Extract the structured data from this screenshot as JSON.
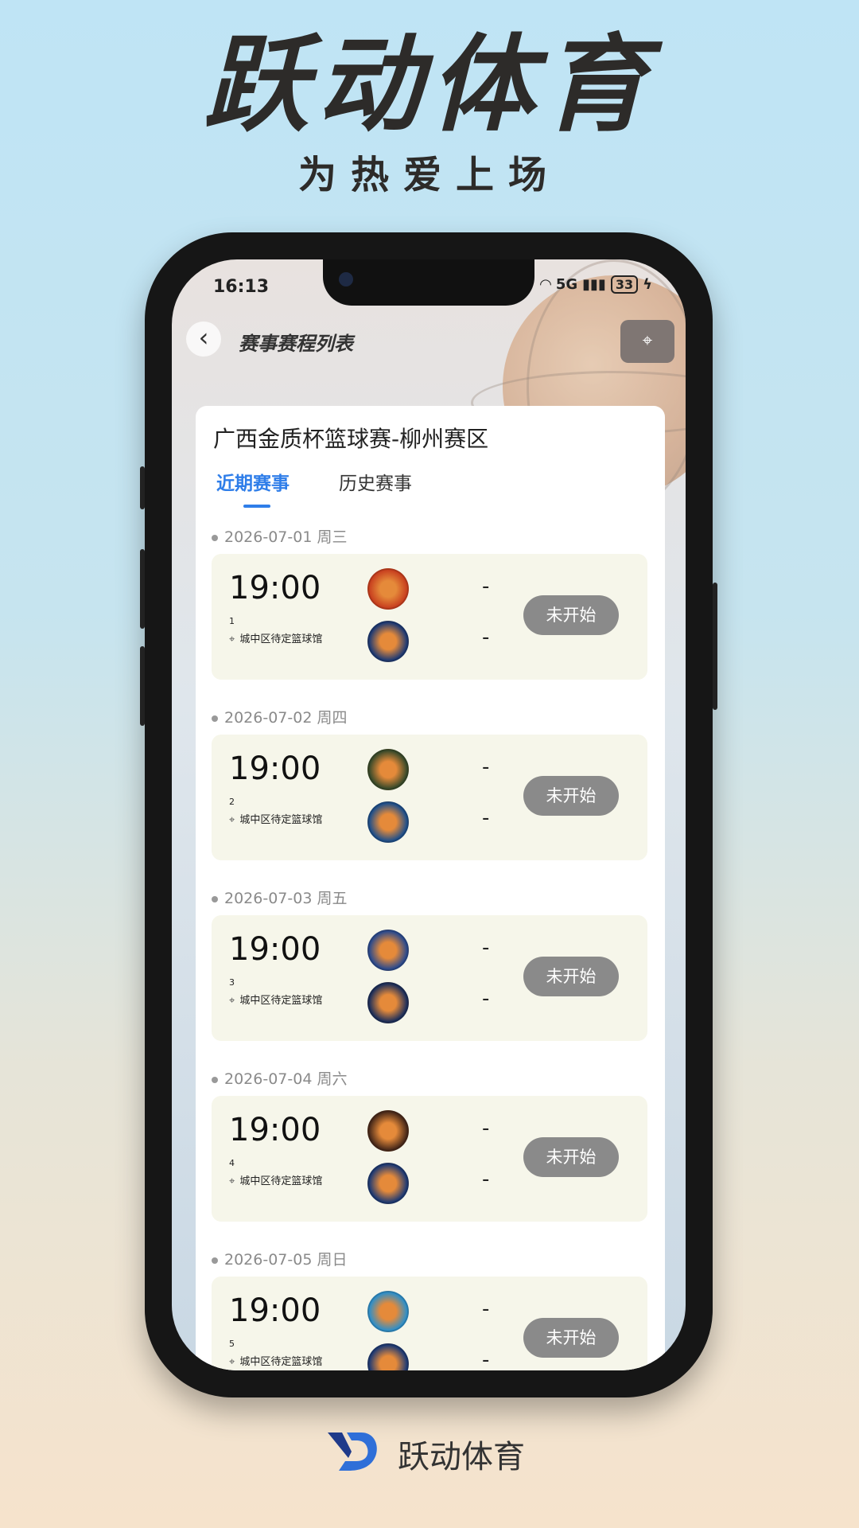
{
  "hero": {
    "title": "跃动体育",
    "subtitle": "为热爱上场"
  },
  "status_bar": {
    "time": "16:13",
    "signal": "5G",
    "battery": "33"
  },
  "nav": {
    "title": "赛事赛程列表"
  },
  "league": {
    "title": "广西金质杯篮球赛-柳州赛区"
  },
  "tabs": [
    {
      "label": "近期赛事",
      "active": true
    },
    {
      "label": "历史赛事",
      "active": false
    }
  ],
  "matches": [
    {
      "date": "2026-07-01 周三",
      "time": "19:00",
      "number": "1",
      "venue": "城中区待定篮球馆",
      "home_score": "-",
      "away_score": "-",
      "status": "未开始",
      "home_logo_color": "#c8401f",
      "away_logo_color": "#1f3a73"
    },
    {
      "date": "2026-07-02 周四",
      "time": "19:00",
      "number": "2",
      "venue": "城中区待定篮球馆",
      "home_score": "-",
      "away_score": "-",
      "status": "未开始",
      "home_logo_color": "#3a4a2a",
      "away_logo_color": "#1f4f8a"
    },
    {
      "date": "2026-07-03 周五",
      "time": "19:00",
      "number": "3",
      "venue": "城中区待定篮球馆",
      "home_score": "-",
      "away_score": "-",
      "status": "未开始",
      "home_logo_color": "#2c4a8c",
      "away_logo_color": "#1e2f5a"
    },
    {
      "date": "2026-07-04 周六",
      "time": "19:00",
      "number": "4",
      "venue": "城中区待定篮球馆",
      "home_score": "-",
      "away_score": "-",
      "status": "未开始",
      "home_logo_color": "#4a2a1a",
      "away_logo_color": "#1f3a73"
    },
    {
      "date": "2026-07-05 周日",
      "time": "19:00",
      "number": "5",
      "venue": "城中区待定篮球馆",
      "home_score": "-",
      "away_score": "-",
      "status": "未开始",
      "home_logo_color": "#2f8fc8",
      "away_logo_color": "#1f3a73"
    }
  ],
  "footer": {
    "brand": "跃动体育"
  },
  "colors": {
    "accent": "#2f7ee9",
    "card_bg": "#f6f6ea",
    "status_button": "#8a8a8a"
  }
}
